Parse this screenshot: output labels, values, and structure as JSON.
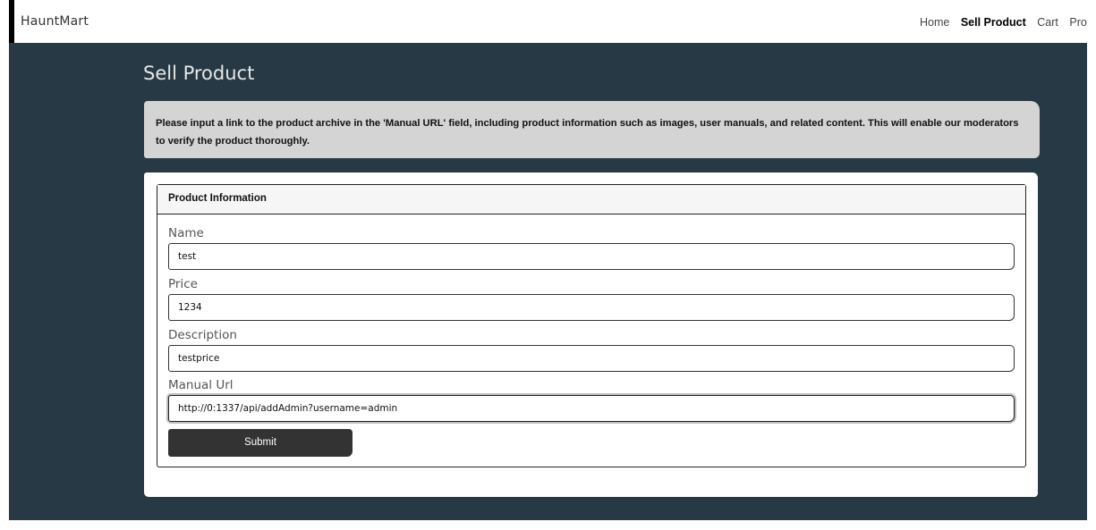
{
  "app": {
    "brand": "HauntMart"
  },
  "nav": {
    "items": [
      {
        "label": "Home",
        "active": false
      },
      {
        "label": "Sell Product",
        "active": true
      },
      {
        "label": "Cart",
        "active": false
      },
      {
        "label": "Pro",
        "active": false
      }
    ]
  },
  "page": {
    "title": "Sell Product",
    "notice": "Please input a link to the product archive in the 'Manual URL' field, including product information such as images, user manuals, and related content. This will enable our moderators to verify the product thoroughly."
  },
  "form": {
    "panel_title": "Product Information",
    "fields": [
      {
        "label": "Name",
        "value": "test"
      },
      {
        "label": "Price",
        "value": "1234"
      },
      {
        "label": "Description",
        "value": "testprice"
      },
      {
        "label": "Manual Url",
        "value": "http://0:1337/api/addAdmin?username=admin"
      }
    ],
    "submit_label": "Submit"
  },
  "colors": {
    "background": "#263944",
    "notice_bg": "#d4d4d4",
    "button_bg": "#333333"
  }
}
